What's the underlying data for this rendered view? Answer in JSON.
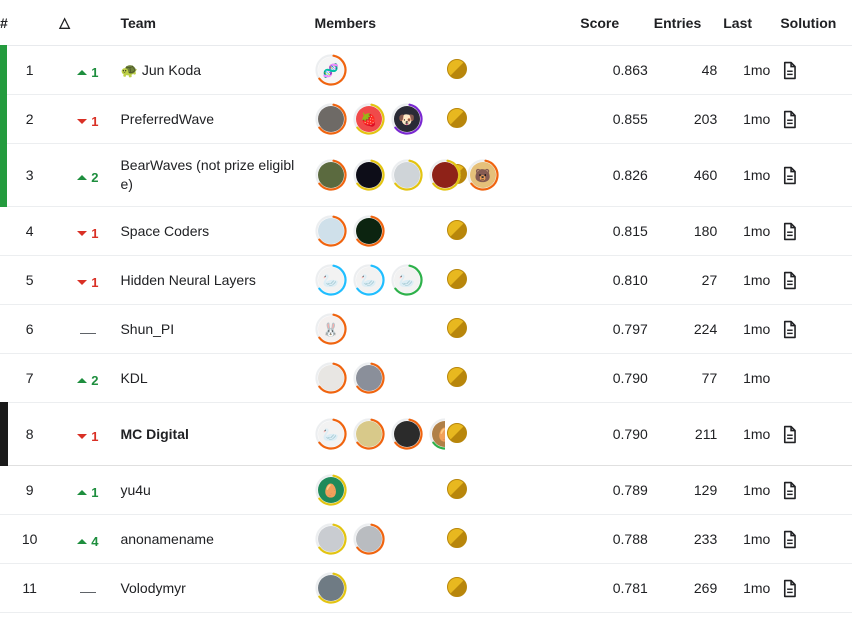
{
  "table": {
    "headers": {
      "rank": "#",
      "delta": "△",
      "team": "Team",
      "members": "Members",
      "score": "Score",
      "entries": "Entries",
      "last": "Last",
      "solution": "Solution"
    },
    "colors": {
      "gold_zone_bar": "#249b3e",
      "highlight_bar": "#1a1a1a",
      "delta_up": "#1e8e3e",
      "delta_down": "#d93025",
      "medal_gold": "#e8b81f",
      "tier_expert": "#f0640f",
      "tier_master": "#e3c411",
      "tier_grandmaster": "#7a28d1",
      "tier_contributor": "#20beff",
      "tier_novice": "#2db14a"
    },
    "rows": [
      {
        "rank": "1",
        "delta_dir": "up",
        "delta_value": "1",
        "team": "Jun Koda",
        "team_emoji": "🐢",
        "bold": false,
        "zone": "gold",
        "highlight": false,
        "tall": false,
        "medal": "gold",
        "score": "0.863",
        "entries": "48",
        "last": "1mo",
        "solution": true,
        "members": [
          {
            "ring": "#f0640f",
            "bg": "#f5f5f5",
            "glyph": "🧬"
          }
        ]
      },
      {
        "rank": "2",
        "delta_dir": "down",
        "delta_value": "1",
        "team": "PreferredWave",
        "team_emoji": "",
        "bold": false,
        "zone": "gold",
        "highlight": false,
        "tall": false,
        "medal": "gold",
        "score": "0.855",
        "entries": "203",
        "last": "1mo",
        "solution": true,
        "members": [
          {
            "ring": "#f0640f",
            "bg": "#6e6a66",
            "glyph": ""
          },
          {
            "ring": "#e3c411",
            "bg": "#f04a4a",
            "glyph": "🍓"
          },
          {
            "ring": "#7a28d1",
            "bg": "#2a2a35",
            "glyph": "🐶"
          }
        ]
      },
      {
        "rank": "3",
        "delta_dir": "up",
        "delta_value": "2",
        "team": "BearWaves (not prize eligible)",
        "team_emoji": "",
        "bold": false,
        "zone": "gold",
        "highlight": false,
        "tall": true,
        "medal": "gold",
        "score": "0.826",
        "entries": "460",
        "last": "1mo",
        "solution": true,
        "members": [
          {
            "ring": "#f0640f",
            "bg": "#5b6a3f",
            "glyph": ""
          },
          {
            "ring": "#e3c411",
            "bg": "#0d0d18",
            "glyph": ""
          },
          {
            "ring": "#e3c411",
            "bg": "#cfd4d8",
            "glyph": ""
          },
          {
            "ring": "#e3c411",
            "bg": "#8e2218",
            "glyph": ""
          },
          {
            "ring": "#f0640f",
            "bg": "#e5c07a",
            "glyph": "🐻"
          }
        ]
      },
      {
        "rank": "4",
        "delta_dir": "down",
        "delta_value": "1",
        "team": "Space Coders",
        "team_emoji": "",
        "bold": false,
        "zone": "none",
        "highlight": false,
        "tall": false,
        "medal": "gold",
        "score": "0.815",
        "entries": "180",
        "last": "1mo",
        "solution": true,
        "members": [
          {
            "ring": "#f0640f",
            "bg": "#cfe0ea",
            "glyph": ""
          },
          {
            "ring": "#f0640f",
            "bg": "#0c2410",
            "glyph": ""
          }
        ]
      },
      {
        "rank": "5",
        "delta_dir": "down",
        "delta_value": "1",
        "team": "Hidden Neural Layers",
        "team_emoji": "",
        "bold": false,
        "zone": "none",
        "highlight": false,
        "tall": false,
        "medal": "gold",
        "score": "0.810",
        "entries": "27",
        "last": "1mo",
        "solution": true,
        "members": [
          {
            "ring": "#20beff",
            "bg": "#f2f2f2",
            "glyph": "🦢"
          },
          {
            "ring": "#20beff",
            "bg": "#f2f2f2",
            "glyph": "🦢"
          },
          {
            "ring": "#2db14a",
            "bg": "#f2f2f2",
            "glyph": "🦢"
          }
        ]
      },
      {
        "rank": "6",
        "delta_dir": "flat",
        "delta_value": "",
        "team": "Shun_PI",
        "team_emoji": "",
        "bold": false,
        "zone": "none",
        "highlight": false,
        "tall": false,
        "medal": "gold",
        "score": "0.797",
        "entries": "224",
        "last": "1mo",
        "solution": true,
        "members": [
          {
            "ring": "#f0640f",
            "bg": "#f4f0ef",
            "glyph": "🐰"
          }
        ]
      },
      {
        "rank": "7",
        "delta_dir": "up",
        "delta_value": "2",
        "team": "KDL",
        "team_emoji": "",
        "bold": false,
        "zone": "none",
        "highlight": false,
        "tall": false,
        "medal": "gold",
        "score": "0.790",
        "entries": "77",
        "last": "1mo",
        "solution": false,
        "members": [
          {
            "ring": "#f0640f",
            "bg": "#e8e6e3",
            "glyph": ""
          },
          {
            "ring": "#f0640f",
            "bg": "#8a8f9a",
            "glyph": ""
          }
        ]
      },
      {
        "rank": "8",
        "delta_dir": "down",
        "delta_value": "1",
        "team": "MC Digital",
        "team_emoji": "",
        "bold": true,
        "zone": "me",
        "highlight": true,
        "tall": false,
        "medal": "gold",
        "score": "0.790",
        "entries": "211",
        "last": "1mo",
        "solution": true,
        "members": [
          {
            "ring": "#f0640f",
            "bg": "#f2f2f2",
            "glyph": "🦢"
          },
          {
            "ring": "#f0640f",
            "bg": "#d8c98a",
            "glyph": ""
          },
          {
            "ring": "#f0640f",
            "bg": "#2b2b2b",
            "glyph": ""
          },
          {
            "ring": "#2db14a",
            "bg": "#b08048",
            "glyph": "🥚"
          }
        ]
      },
      {
        "rank": "9",
        "delta_dir": "up",
        "delta_value": "1",
        "team": "yu4u",
        "team_emoji": "",
        "bold": false,
        "zone": "none",
        "highlight": false,
        "tall": false,
        "medal": "gold",
        "score": "0.789",
        "entries": "129",
        "last": "1mo",
        "solution": true,
        "members": [
          {
            "ring": "#e3c411",
            "bg": "#1f8a5a",
            "glyph": "🥚"
          }
        ]
      },
      {
        "rank": "10",
        "delta_dir": "up",
        "delta_value": "4",
        "team": "anonamename",
        "team_emoji": "",
        "bold": false,
        "zone": "none",
        "highlight": false,
        "tall": false,
        "medal": "gold",
        "score": "0.788",
        "entries": "233",
        "last": "1mo",
        "solution": true,
        "members": [
          {
            "ring": "#e3c411",
            "bg": "#c9ccd1",
            "glyph": ""
          },
          {
            "ring": "#f0640f",
            "bg": "#b9bcc0",
            "glyph": ""
          }
        ]
      },
      {
        "rank": "11",
        "delta_dir": "flat",
        "delta_value": "",
        "team": "Volodymyr",
        "team_emoji": "",
        "bold": false,
        "zone": "none",
        "highlight": false,
        "tall": false,
        "medal": "gold",
        "score": "0.781",
        "entries": "269",
        "last": "1mo",
        "solution": true,
        "members": [
          {
            "ring": "#e3c411",
            "bg": "#6f7b84",
            "glyph": ""
          }
        ]
      }
    ]
  }
}
